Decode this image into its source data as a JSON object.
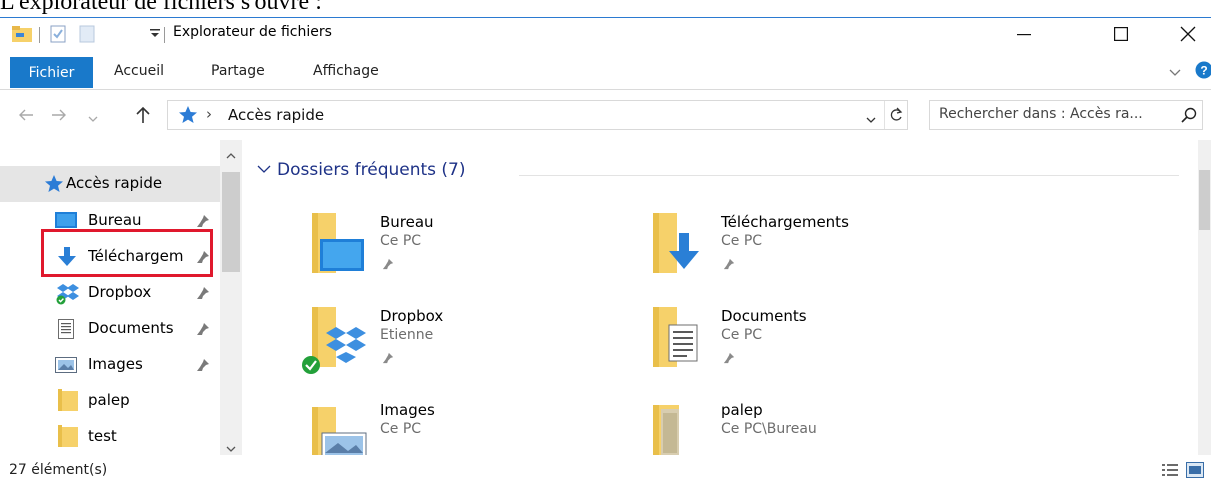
{
  "caption_cut": "L'explorateur de fichiers s'ouvre :",
  "window": {
    "title": "Explorateur de fichiers",
    "minimize_glyph": "—",
    "maximize_glyph": "☐",
    "close_glyph": "✕"
  },
  "ribbon": {
    "tabs": [
      "Fichier",
      "Accueil",
      "Partage",
      "Affichage"
    ]
  },
  "address": {
    "path": "Accès rapide",
    "separator": "›"
  },
  "search": {
    "placeholder": "Rechercher dans : Accès ra..."
  },
  "nav": {
    "items": [
      {
        "label": "Accès rapide",
        "icon": "star-quick-access-icon",
        "pinned": false
      },
      {
        "label": "Bureau",
        "icon": "desktop-icon",
        "pinned": true
      },
      {
        "label": "Téléchargem",
        "icon": "download-arrow-icon",
        "pinned": true
      },
      {
        "label": "Dropbox",
        "icon": "dropbox-icon",
        "pinned": true
      },
      {
        "label": "Documents",
        "icon": "documents-icon",
        "pinned": true
      },
      {
        "label": "Images",
        "icon": "images-icon",
        "pinned": true
      },
      {
        "label": "palep",
        "icon": "folder-icon",
        "pinned": false
      },
      {
        "label": "test",
        "icon": "folder-icon",
        "pinned": false
      }
    ]
  },
  "content": {
    "group_title": "Dossiers fréquents (7)",
    "tiles": [
      {
        "name": "Bureau",
        "sub": "Ce PC",
        "icon": "desktop-folder-icon"
      },
      {
        "name": "Téléchargements",
        "sub": "Ce PC",
        "icon": "downloads-folder-icon"
      },
      {
        "name": "Dropbox",
        "sub": "Etienne",
        "icon": "dropbox-folder-icon"
      },
      {
        "name": "Documents",
        "sub": "Ce PC",
        "icon": "documents-folder-icon"
      },
      {
        "name": "Images",
        "sub": "Ce PC",
        "icon": "images-folder-icon"
      },
      {
        "name": "palep",
        "sub": "Ce PC\\Bureau",
        "icon": "palep-folder-icon"
      }
    ]
  },
  "status": {
    "count": "27 élément(s)"
  },
  "colors": {
    "accent": "#1979ca",
    "folder": "#f6d16a",
    "highlight": "#e0182d",
    "group_title": "#1e3287"
  }
}
